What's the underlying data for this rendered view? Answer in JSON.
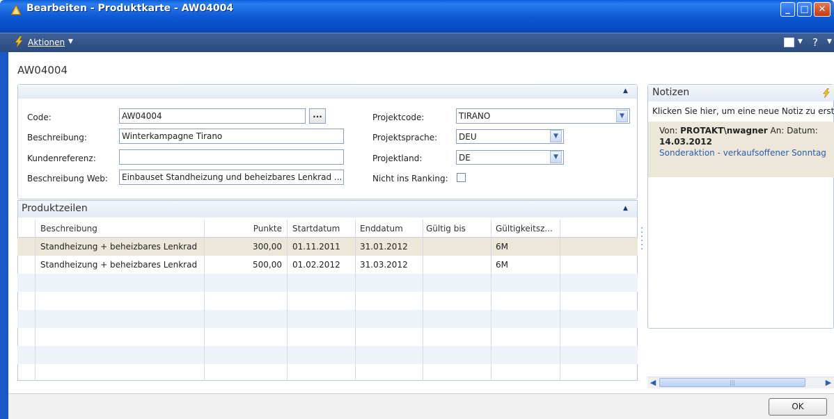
{
  "window": {
    "title": "Bearbeiten - Produktkarte - AW04004",
    "actions_label": "Aktionen"
  },
  "record_title": "AW04004",
  "general": {
    "code_label": "Code:",
    "code_value": "AW04004",
    "assist_label": "...",
    "beschreibung_label": "Beschreibung:",
    "beschreibung_value": "Winterkampagne Tirano",
    "kundenreferenz_label": "Kundenreferenz:",
    "kundenreferenz_value": "",
    "web_label": "Beschreibung Web:",
    "web_value": "Einbauset Standheizung und beheizbares Lenkrad ...",
    "projektcode_label": "Projektcode:",
    "projektcode_value": "TIRANO",
    "projektsprache_label": "Projektsprache:",
    "projektsprache_value": "DEU",
    "projektland_label": "Projektland:",
    "projektland_value": "DE",
    "ranking_label": "Nicht ins Ranking:"
  },
  "lines": {
    "title": "Produktzeilen",
    "columns": {
      "beschreibung": "Beschreibung",
      "punkte": "Punkte",
      "startdatum": "Startdatum",
      "enddatum": "Enddatum",
      "gueltig_bis": "Gültig bis",
      "gueltigkeit": "Gültigkeitsz..."
    },
    "rows": [
      {
        "beschreibung": "Standheizung + beheizbares Lenkrad",
        "punkte": "300,00",
        "startdatum": "01.11.2011",
        "enddatum": "31.01.2012",
        "gueltig_bis": "",
        "gueltigkeit": "6M"
      },
      {
        "beschreibung": "Standheizung + beheizbares Lenkrad",
        "punkte": "500,00",
        "startdatum": "01.02.2012",
        "enddatum": "31.03.2012",
        "gueltig_bis": "",
        "gueltigkeit": "6M"
      }
    ]
  },
  "notes": {
    "title": "Notizen",
    "new_note_text": "Klicken Sie hier, um eine neue Notiz zu erstel",
    "note": {
      "from_label": "Von:",
      "author": "PROTAKT\\nwagner",
      "to_label": "An:",
      "date_label": "Datum:",
      "date": "14.03.2012",
      "text": "Sonderaktion - verkaufsoffener Sonntag"
    }
  },
  "footer": {
    "ok_label": "OK"
  },
  "colors": {
    "titlebar": "#0b56d1",
    "actionbar": "#2b4a80",
    "selected_row": "#ece7d8",
    "link": "#2a5db0"
  }
}
